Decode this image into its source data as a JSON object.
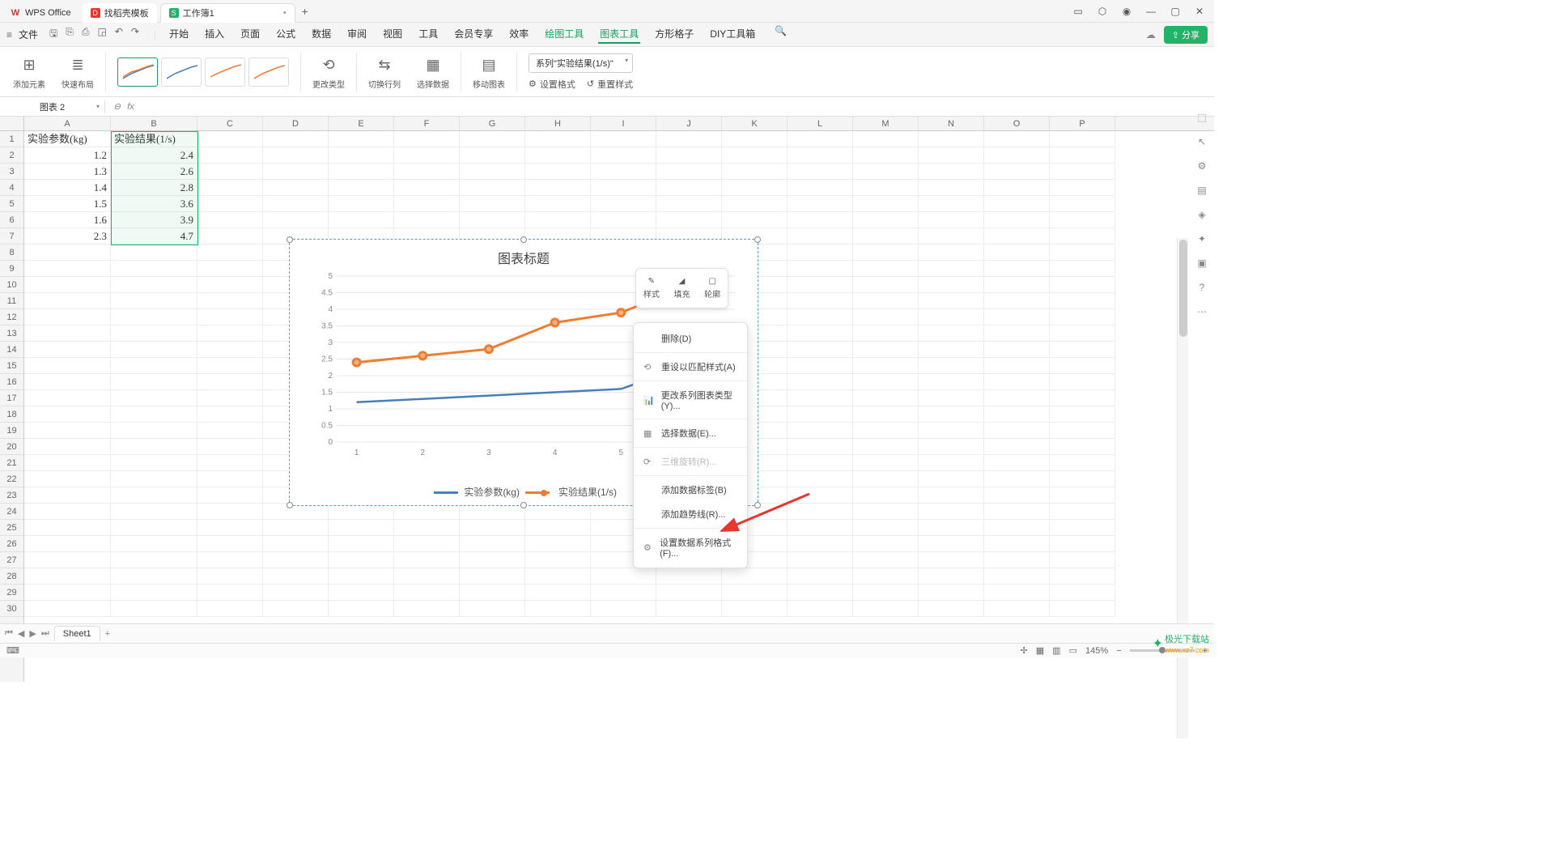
{
  "titlebar": {
    "app": "WPS Office",
    "template_tab": "找稻壳模板",
    "doc_tab": "工作簿1"
  },
  "menubar": {
    "file": "文件",
    "tabs": [
      "开始",
      "插入",
      "页面",
      "公式",
      "数据",
      "审阅",
      "视图",
      "工具",
      "会员专享",
      "效率",
      "绘图工具",
      "图表工具",
      "方形格子",
      "DIY工具箱"
    ],
    "share": "分享"
  },
  "ribbon": {
    "add_element": "添加元素",
    "quick_layout": "快速布局",
    "change_type": "更改类型",
    "switch_rc": "切换行列",
    "select_data": "选择数据",
    "move_chart": "移动图表",
    "series_selected": "系列\"实验结果(1/s)\"",
    "set_format": "设置格式",
    "reset_style": "重置样式"
  },
  "namebox": "图表 2",
  "fx": "fx",
  "columns": [
    "A",
    "B",
    "C",
    "D",
    "E",
    "F",
    "G",
    "H",
    "I",
    "J",
    "K",
    "L",
    "M",
    "N",
    "O",
    "P"
  ],
  "rows_count": 30,
  "data_cells": {
    "A1": "实验参数(kg)",
    "B1": "实验结果(1/s)",
    "A2": "1.2",
    "B2": "2.4",
    "A3": "1.3",
    "B3": "2.6",
    "A4": "1.4",
    "B4": "2.8",
    "A5": "1.5",
    "B5": "3.6",
    "A6": "1.6",
    "B6": "3.9",
    "A7": "2.3",
    "B7": "4.7"
  },
  "chart_data": {
    "type": "line",
    "title": "图表标题",
    "x": [
      1,
      2,
      3,
      4,
      5,
      6
    ],
    "series": [
      {
        "name": "实验参数(kg)",
        "values": [
          1.2,
          1.3,
          1.4,
          1.5,
          1.6,
          2.3
        ],
        "color": "#4a7ebb"
      },
      {
        "name": "实验结果(1/s)",
        "values": [
          2.4,
          2.6,
          2.8,
          3.6,
          3.9,
          4.7
        ],
        "color": "#ed7d31",
        "markers": true,
        "selected": true
      }
    ],
    "ylim": [
      0,
      5
    ],
    "ystep": 0.5,
    "xlabel": "",
    "ylabel": ""
  },
  "mini_toolbar": {
    "style": "样式",
    "fill": "填充",
    "outline": "轮廓"
  },
  "context_menu": {
    "delete": "删除(D)",
    "reset_match": "重设以匹配样式(A)",
    "change_series_type": "更改系列图表类型(Y)...",
    "select_data": "选择数据(E)...",
    "rotate3d": "三维旋转(R)...",
    "add_label": "添加数据标签(B)",
    "add_trend": "添加趋势线(R)...",
    "format_series": "设置数据系列格式(F)..."
  },
  "sheet": {
    "name": "Sheet1"
  },
  "status": {
    "left_icon": "⌨",
    "zoom": "145%"
  },
  "watermark": {
    "name": "极光下载站",
    "url": "www.xz7.com"
  }
}
